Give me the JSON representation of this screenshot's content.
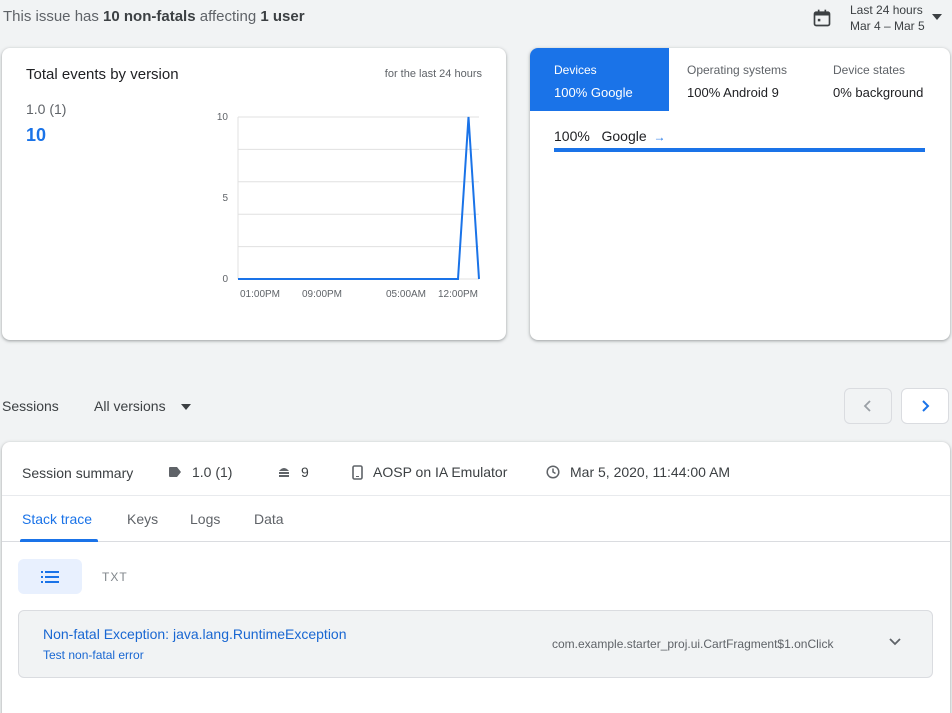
{
  "header": {
    "prefix": "This issue has",
    "count": "10 non-fatals",
    "middle": "affecting",
    "users": "1 user"
  },
  "date_range": {
    "icon": "calendar-icon",
    "label": "Last 24 hours",
    "range": "Mar 4 – Mar 5"
  },
  "events_card": {
    "title": "Total events by version",
    "subtitle": "for the last 24 hours",
    "version": "1.0 (1)",
    "count": "10"
  },
  "chart_data": {
    "type": "line",
    "x_ticks": [
      "01:00PM",
      "09:00PM",
      "05:00AM",
      "12:00PM"
    ],
    "y_ticks": [
      "0",
      "5",
      "10"
    ],
    "ylim": [
      0,
      10
    ],
    "series": [
      {
        "values": [
          0,
          0,
          0,
          0,
          0,
          0,
          0,
          0,
          0,
          0,
          0,
          0,
          0,
          0,
          0,
          0,
          0,
          0,
          0,
          0,
          0,
          0,
          10,
          0
        ]
      }
    ],
    "color": "#1a73e8",
    "grid": true
  },
  "devices_card": {
    "tabs": [
      {
        "label": "Devices",
        "value": "100% Google"
      },
      {
        "label": "Operating systems",
        "value": "100% Android 9"
      },
      {
        "label": "Device states",
        "value": "0% background"
      }
    ],
    "row": {
      "percent": "100%",
      "name": "Google",
      "arrow": "→"
    },
    "bar_fraction": 1.0
  },
  "sessions": {
    "label": "Sessions",
    "versions_select": "All versions",
    "prev_icon": "chevron-left-icon",
    "next_icon": "chevron-right-icon"
  },
  "session_summary": {
    "label": "Session summary",
    "version": "1.0 (1)",
    "os": "9",
    "device": "AOSP on IA Emulator",
    "time": "Mar 5, 2020, 11:44:00 AM"
  },
  "tabs": [
    "Stack trace",
    "Keys",
    "Logs",
    "Data"
  ],
  "view": {
    "list_icon": "list-icon",
    "txt": "TXT"
  },
  "exception": {
    "title": "Non-fatal Exception: java.lang.RuntimeException",
    "subtitle": "Test non-fatal error",
    "location": "com.example.starter_proj.ui.CartFragment$1.onClick"
  },
  "colors": {
    "accent": "#1a73e8",
    "background": "#f1f3f4"
  }
}
